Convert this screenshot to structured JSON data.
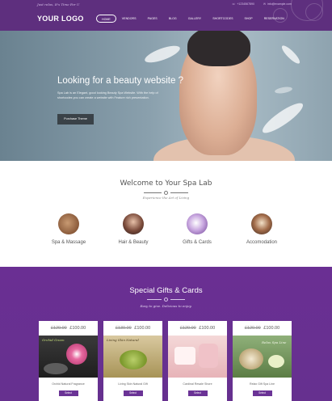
{
  "header": {
    "tagline": "Just relax, It's Time For U",
    "phone": "+1234567890",
    "email": "info@example.com",
    "logo": "YOUR LOGO",
    "nav": [
      "HOME",
      "VENDORS",
      "PAGES",
      "BLOG",
      "GALLERY",
      "SHORTCODES",
      "SHOP",
      "RESERVATION"
    ]
  },
  "hero": {
    "title": "Looking for a beauty website ?",
    "description": "Spa Lab is an Elegant, good looking Beauty Spa Website. With the help of shortcodes you can create a website with Feature rich presentation.",
    "button": "Purchase Theme"
  },
  "welcome": {
    "title": "Welcome to Your Spa Lab",
    "subtitle": "Experience the Art of Living",
    "services": [
      {
        "label": "Spa & Massage",
        "icon": "spa-massage-icon"
      },
      {
        "label": "Hair & Beauty",
        "icon": "hair-beauty-icon"
      },
      {
        "label": "Gifts & Cards",
        "icon": "gifts-cards-icon"
      },
      {
        "label": "Accomodation",
        "icon": "accomodation-icon"
      }
    ]
  },
  "gifts": {
    "title": "Special Gifts & Cards",
    "subtitle": "Easy to give. Delicious to enjoy.",
    "cards": [
      {
        "old_price": "£120.00",
        "new_price": "£100.00",
        "name": "Orchid Natural Fragrance",
        "image_caption": "Orchid Green",
        "button": "Select"
      },
      {
        "old_price": "£130.00",
        "new_price": "£100.00",
        "name": "Living Skin Natural Gift",
        "image_caption": "Living Skin Natural",
        "button": "Select"
      },
      {
        "old_price": "£120.00",
        "new_price": "£100.00",
        "name": "Cardinal Resale Shore",
        "image_caption": "",
        "button": "Select"
      },
      {
        "old_price": "£120.00",
        "new_price": "£100.00",
        "name": "Relax Gift Spa Line",
        "image_caption": "Relax Spa Line",
        "button": "Select"
      }
    ]
  },
  "colors": {
    "brand_purple": "#5e2f7e",
    "gift_section": "#6a2f93",
    "button_dark": "#3a4248"
  }
}
